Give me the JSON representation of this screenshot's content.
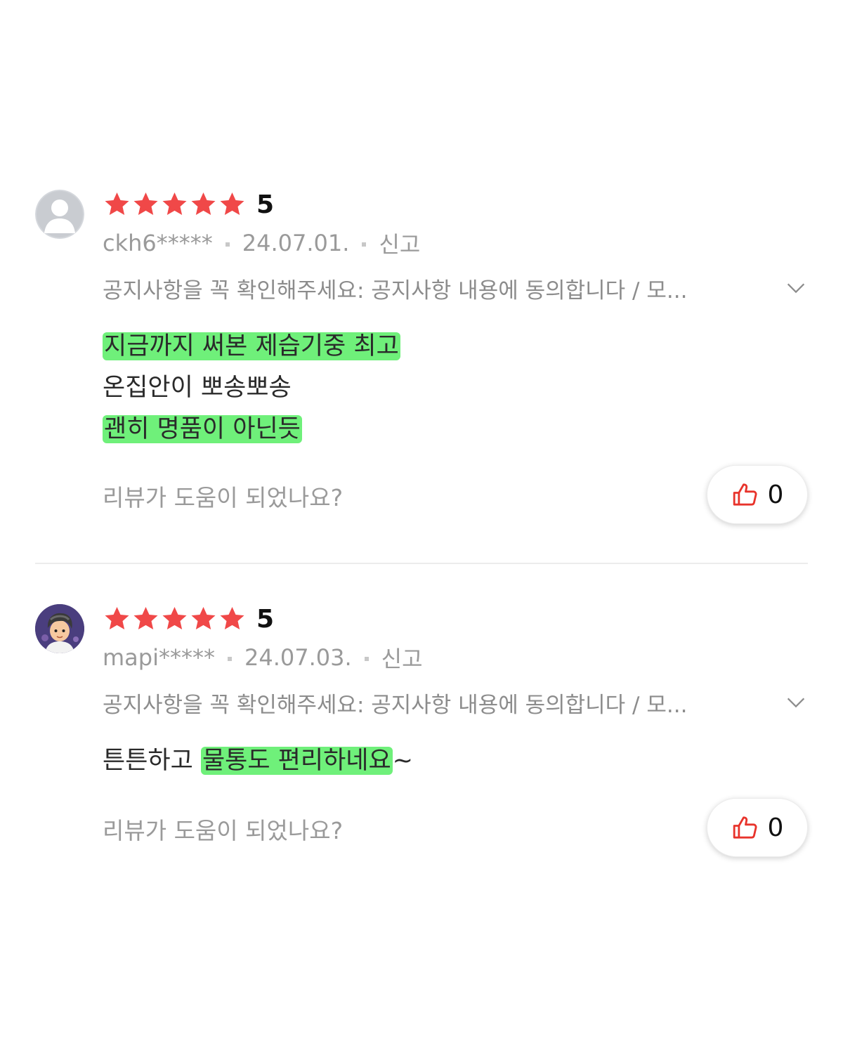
{
  "colors": {
    "star": "#f04848",
    "highlight": "#6ff07a",
    "thumb": "#e8332b",
    "meta_text": "#9a9a9a"
  },
  "reviews": [
    {
      "avatar_icon": "default-user-avatar",
      "rating_value": 5,
      "rating_text": "5",
      "username": "ckh6*****",
      "date": "24.07.01.",
      "report_label": "신고",
      "option_text": "공지사항을 꼭 확인해주세요: 공지사항 내용에 동의합니다 / 모...",
      "body_lines": [
        {
          "before": "",
          "highlight": "지금까지 써본 제습기중 최고",
          "after": ""
        },
        {
          "before": "온집안이 뽀송뽀송",
          "highlight": "",
          "after": ""
        },
        {
          "before": "",
          "highlight": "괜히 명품이 아닌듯",
          "after": ""
        }
      ],
      "helpful_question": "리뷰가 도움이 되었나요?",
      "like_count": "0"
    },
    {
      "avatar_icon": "character-avatar",
      "rating_value": 5,
      "rating_text": "5",
      "username": "mapi*****",
      "date": "24.07.03.",
      "report_label": "신고",
      "option_text": "공지사항을 꼭 확인해주세요: 공지사항 내용에 동의합니다 / 모...",
      "body_lines": [
        {
          "before": "튼튼하고 ",
          "highlight": "물통도 편리하네요",
          "after": "~"
        }
      ],
      "helpful_question": "리뷰가 도움이 되었나요?",
      "like_count": "0"
    }
  ]
}
